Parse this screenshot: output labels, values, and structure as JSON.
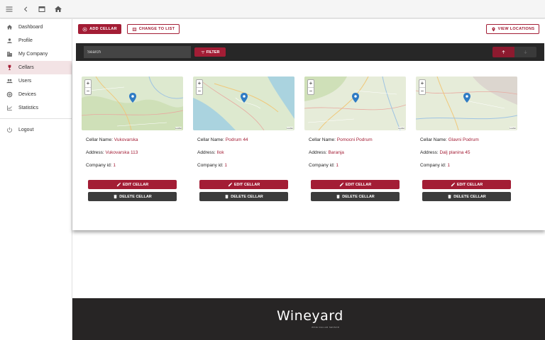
{
  "topbar": {
    "icons": [
      "menu-icon",
      "back-icon",
      "window-icon",
      "home-icon"
    ]
  },
  "sidebar": {
    "items": [
      {
        "label": "Dashboard",
        "icon": "home-icon"
      },
      {
        "label": "Profile",
        "icon": "person-icon"
      },
      {
        "label": "My Company",
        "icon": "building-icon"
      },
      {
        "label": "Cellars",
        "icon": "wine-icon",
        "active": true
      },
      {
        "label": "Users",
        "icon": "users-icon"
      },
      {
        "label": "Devices",
        "icon": "devices-icon"
      },
      {
        "label": "Statistics",
        "icon": "chart-icon"
      }
    ],
    "logout_label": "Logout"
  },
  "toolbar": {
    "add_label": "ADD CELLAR",
    "change_label": "CHANGE TO LIST",
    "locations_label": "VIEW LOCATIONS"
  },
  "filter": {
    "search_placeholder": "Search",
    "filter_label": "FILTER"
  },
  "labels": {
    "name": "Cellar Name:",
    "address": "Address:",
    "company": "Company id:",
    "edit": "EDIT CELLAR",
    "delete": "DELETE CELLAR",
    "map_attribution": "Leaflet"
  },
  "cellars": [
    {
      "name": "Vukovarska",
      "address": "Vukovarska 113",
      "company_id": "1"
    },
    {
      "name": "Podrum 44",
      "address": "Ilok",
      "company_id": "1"
    },
    {
      "name": "Pomocni Podrum",
      "address": "Baranja",
      "company_id": "1"
    },
    {
      "name": "Glavni Podrum",
      "address": "Dalj planina 45",
      "company_id": "1"
    }
  ],
  "footer": {
    "logo": "Wineyard",
    "tagline": "WINE CELLAR SENSOR"
  },
  "colors": {
    "accent": "#a31d35",
    "dark": "#272727"
  }
}
